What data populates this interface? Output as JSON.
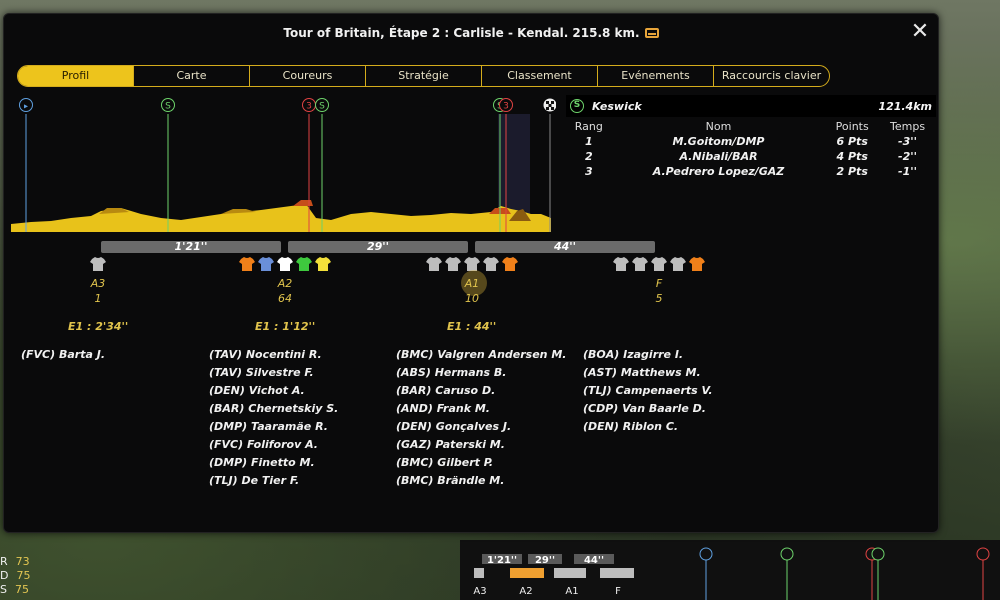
{
  "window": {
    "title": "Tour of Britain, Étape 2 : Carlisle - Kendal. 215.8 km.",
    "close_label": "✕"
  },
  "tabs": [
    {
      "label": "Profil",
      "active": true
    },
    {
      "label": "Carte",
      "active": false
    },
    {
      "label": "Coureurs",
      "active": false
    },
    {
      "label": "Stratégie",
      "active": false
    },
    {
      "label": "Classement",
      "active": false
    },
    {
      "label": "Evénements",
      "active": false
    },
    {
      "label": "Raccourcis clavier",
      "active": false
    }
  ],
  "profile": {
    "markers": [
      {
        "type": "start",
        "glyph": "▸",
        "color": "#5fa0e0"
      },
      {
        "type": "sprint",
        "glyph": "S",
        "color": "#6dd36b"
      },
      {
        "type": "climb",
        "glyph": "3",
        "color": "#e04343"
      },
      {
        "type": "sprint",
        "glyph": "S",
        "color": "#6dd36b"
      },
      {
        "type": "sprint",
        "glyph": "S",
        "color": "#6dd36b"
      },
      {
        "type": "climb",
        "glyph": "3",
        "color": "#e04343"
      },
      {
        "type": "finish",
        "glyph": "",
        "color": "#ffffff"
      }
    ],
    "terrain_color": "#e8c21a"
  },
  "gaps": [
    "1'21''",
    "29''",
    "44''"
  ],
  "groups": [
    {
      "label": "A3",
      "count": "1",
      "jerseys": [
        "#bdbdbd"
      ]
    },
    {
      "label": "A2",
      "count": "64",
      "jerseys": [
        "#f0801a",
        "#6a8fd8",
        "#ffffff",
        "#3ec93e",
        "#f3e03a"
      ]
    },
    {
      "label": "A1",
      "count": "10",
      "jerseys": [
        "#bdbdbd",
        "#bdbdbd",
        "#bdbdbd",
        "#bdbdbd",
        "#f0801a"
      ]
    },
    {
      "label": "F",
      "count": "5",
      "jerseys": [
        "#bdbdbd",
        "#bdbdbd",
        "#bdbdbd",
        "#bdbdbd",
        "#f0801a"
      ]
    }
  ],
  "ecarts": [
    "E1 : 2'34''",
    "E1 : 1'12''",
    "E1 : 44''"
  ],
  "riders": [
    [
      "(FVC) Barta J."
    ],
    [
      "(TAV) Nocentini R.",
      "(TAV) Silvestre F.",
      "(DEN) Vichot A.",
      "(BAR) Chernetskiy S.",
      "(DMP) Taaramäe R.",
      "(FVC) Foliforov A.",
      "(DMP) Finetto M.",
      "(TLJ) De Tier F."
    ],
    [
      "(BMC) Valgren Andersen M.",
      "(ABS) Hermans B.",
      "(BAR) Caruso D.",
      "(AND) Frank M.",
      "(DEN) Gonçalves J.",
      "(GAZ) Paterski M.",
      "(BMC) Gilbert P.",
      "(BMC) Brändle M."
    ],
    [
      "(BOA) Izagirre I.",
      "(AST) Matthews M.",
      "(TLJ) Campenaerts V.",
      "(CDP) Van Baarle D.",
      "(DEN) Riblon C."
    ]
  ],
  "sprint": {
    "icon": "S",
    "name": "Keswick",
    "distance": "121.4km",
    "headers": {
      "rank": "Rang",
      "name": "Nom",
      "points": "Points",
      "time": "Temps"
    },
    "rows": [
      {
        "rank": "1",
        "name": "M.Goitom/DMP",
        "points": "6 Pts",
        "time": "-3''"
      },
      {
        "rank": "2",
        "name": "A.Nibali/BAR",
        "points": "4 Pts",
        "time": "-2''"
      },
      {
        "rank": "3",
        "name": "A.Pedrero Lopez/GAZ",
        "points": "2 Pts",
        "time": "-1''"
      }
    ]
  },
  "mini_strip": {
    "gaps": [
      "1'21''",
      "29''",
      "44''"
    ],
    "groups": [
      "A3",
      "A2",
      "A1",
      "F"
    ]
  },
  "side_stats": [
    {
      "k": "R",
      "v": "73"
    },
    {
      "k": "D",
      "v": "75"
    },
    {
      "k": "S",
      "v": "75"
    }
  ]
}
